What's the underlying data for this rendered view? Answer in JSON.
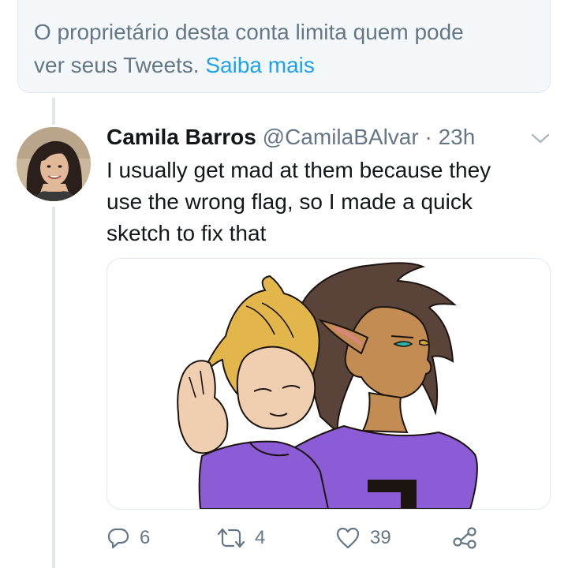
{
  "notice": {
    "text": "O proprietário desta conta limita quem pode ver seus Tweets.",
    "line1": "O proprietário desta conta limita quem pode",
    "line2": "ver seus Tweets.",
    "link_label": "Saiba mais"
  },
  "tweet": {
    "author_name": "Camila Barros",
    "handle": "@CamilaBAlvar",
    "separator": "·",
    "time": "23h",
    "text_lines": [
      "I usually get mad at them because they",
      "use the wrong flag, so I made a quick",
      "sketch to fix that"
    ],
    "media_alt": "drawing of two characters, one with blond hair and one with dark hair and pointed ears, wearing purple"
  },
  "actions": {
    "reply_count": "6",
    "retweet_count": "4",
    "like_count": "39"
  },
  "icons": {
    "reply": "reply-icon",
    "retweet": "retweet-icon",
    "like": "heart-icon",
    "share": "share-icon",
    "caret": "chevron-down-icon"
  },
  "colors": {
    "link": "#1da1f2",
    "secondary_text": "#657786",
    "notice_bg": "#f5f8fa",
    "border": "#e1e8ed",
    "shirt_purple": "#8c5bd6"
  }
}
